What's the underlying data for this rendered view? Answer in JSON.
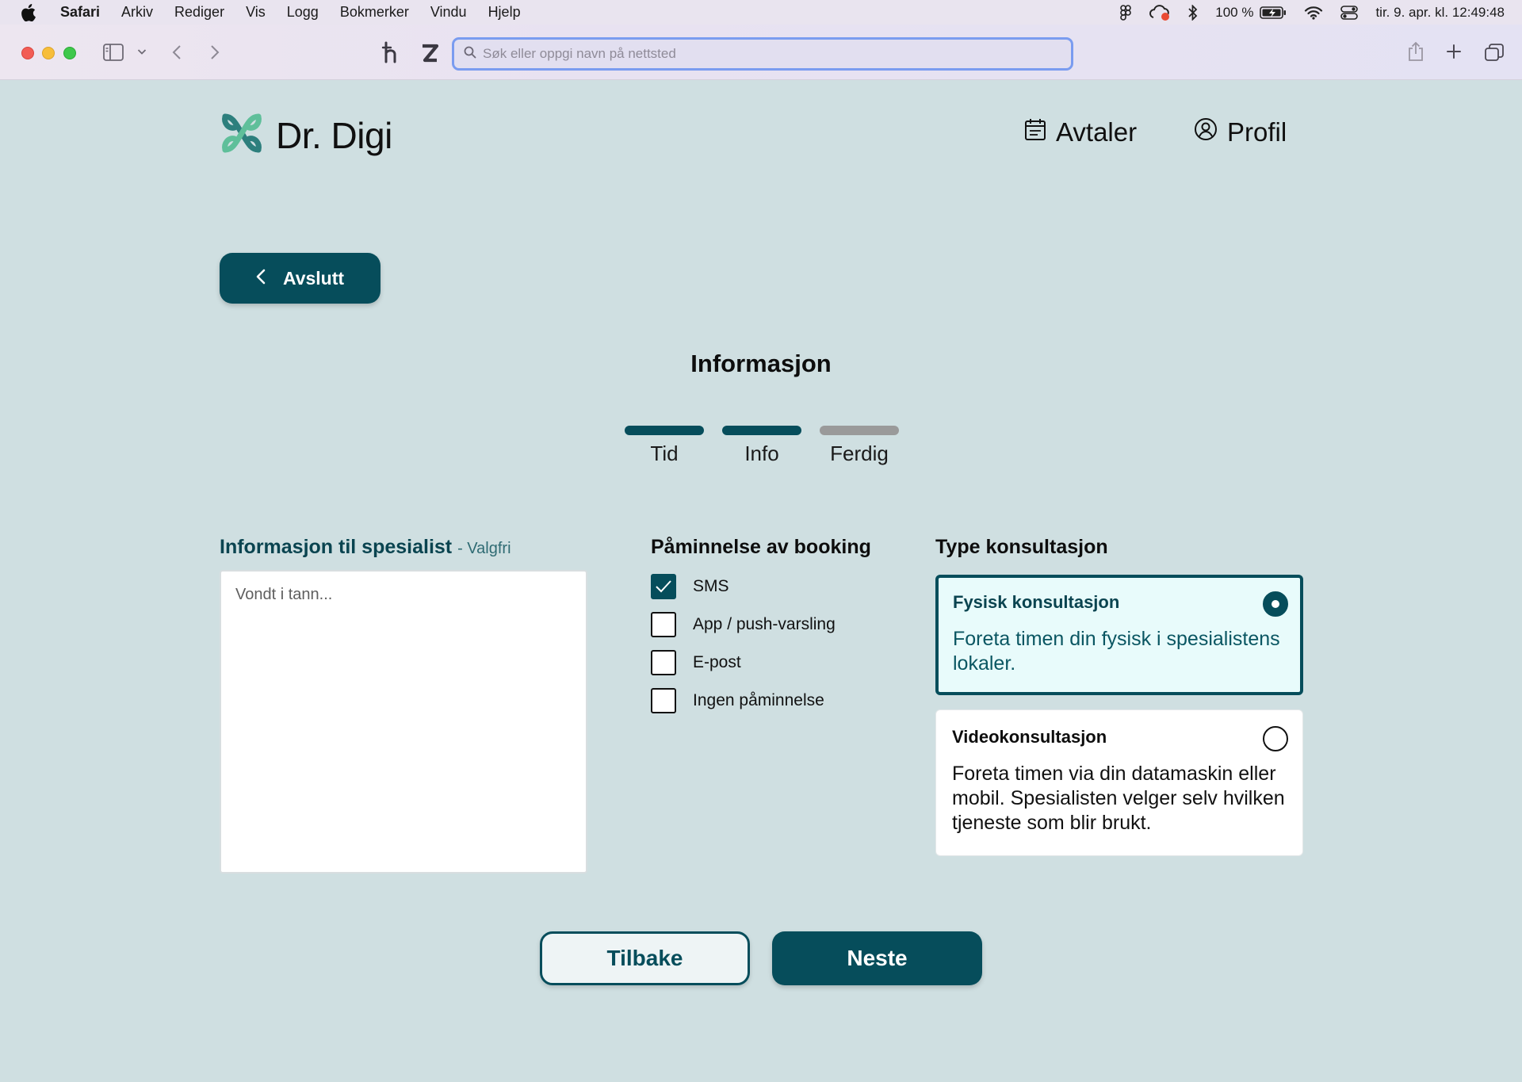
{
  "menubar": {
    "app_name": "Safari",
    "items": [
      "Arkiv",
      "Rediger",
      "Vis",
      "Logg",
      "Bokmerker",
      "Vindu",
      "Hjelp"
    ],
    "battery_percent": "100 %",
    "datetime": "tir. 9. apr. kl. 12:49:48"
  },
  "browser": {
    "address_placeholder": "Søk eller oppgi navn på nettsted"
  },
  "header": {
    "logo_text": "Dr. Digi",
    "nav_appointments": "Avtaler",
    "nav_profile": "Profil"
  },
  "exit_button_label": "Avslutt",
  "page_title": "Informasjon",
  "stepper": {
    "steps": [
      {
        "label": "Tid",
        "state": "done"
      },
      {
        "label": "Info",
        "state": "active"
      },
      {
        "label": "Ferdig",
        "state": "pending"
      }
    ]
  },
  "info_section": {
    "heading": "Informasjon til spesialist",
    "optional_label": "- Valgfri",
    "placeholder": "Vondt i tann..."
  },
  "reminder_section": {
    "heading": "Påminnelse av booking",
    "options": [
      {
        "label": "SMS",
        "checked": true
      },
      {
        "label": "App / push-varsling",
        "checked": false
      },
      {
        "label": "E-post",
        "checked": false
      },
      {
        "label": "Ingen påminnelse",
        "checked": false
      }
    ]
  },
  "consultation_section": {
    "heading": "Type konsultasjon",
    "options": [
      {
        "title": "Fysisk konsultasjon",
        "description": "Foreta timen din fysisk i spesialistens lokaler.",
        "selected": true
      },
      {
        "title": "Videokonsultasjon",
        "description": "Foreta timen via din datamaskin eller mobil. Spesialisten velger selv hvilken tjeneste som blir brukt.",
        "selected": false
      }
    ]
  },
  "footer": {
    "back_label": "Tilbake",
    "next_label": "Neste"
  },
  "colors": {
    "primary": "#064d5b",
    "background": "#cfdfe1",
    "selected_card": "#e8fbfb",
    "pending_step": "#9a9a9a"
  }
}
